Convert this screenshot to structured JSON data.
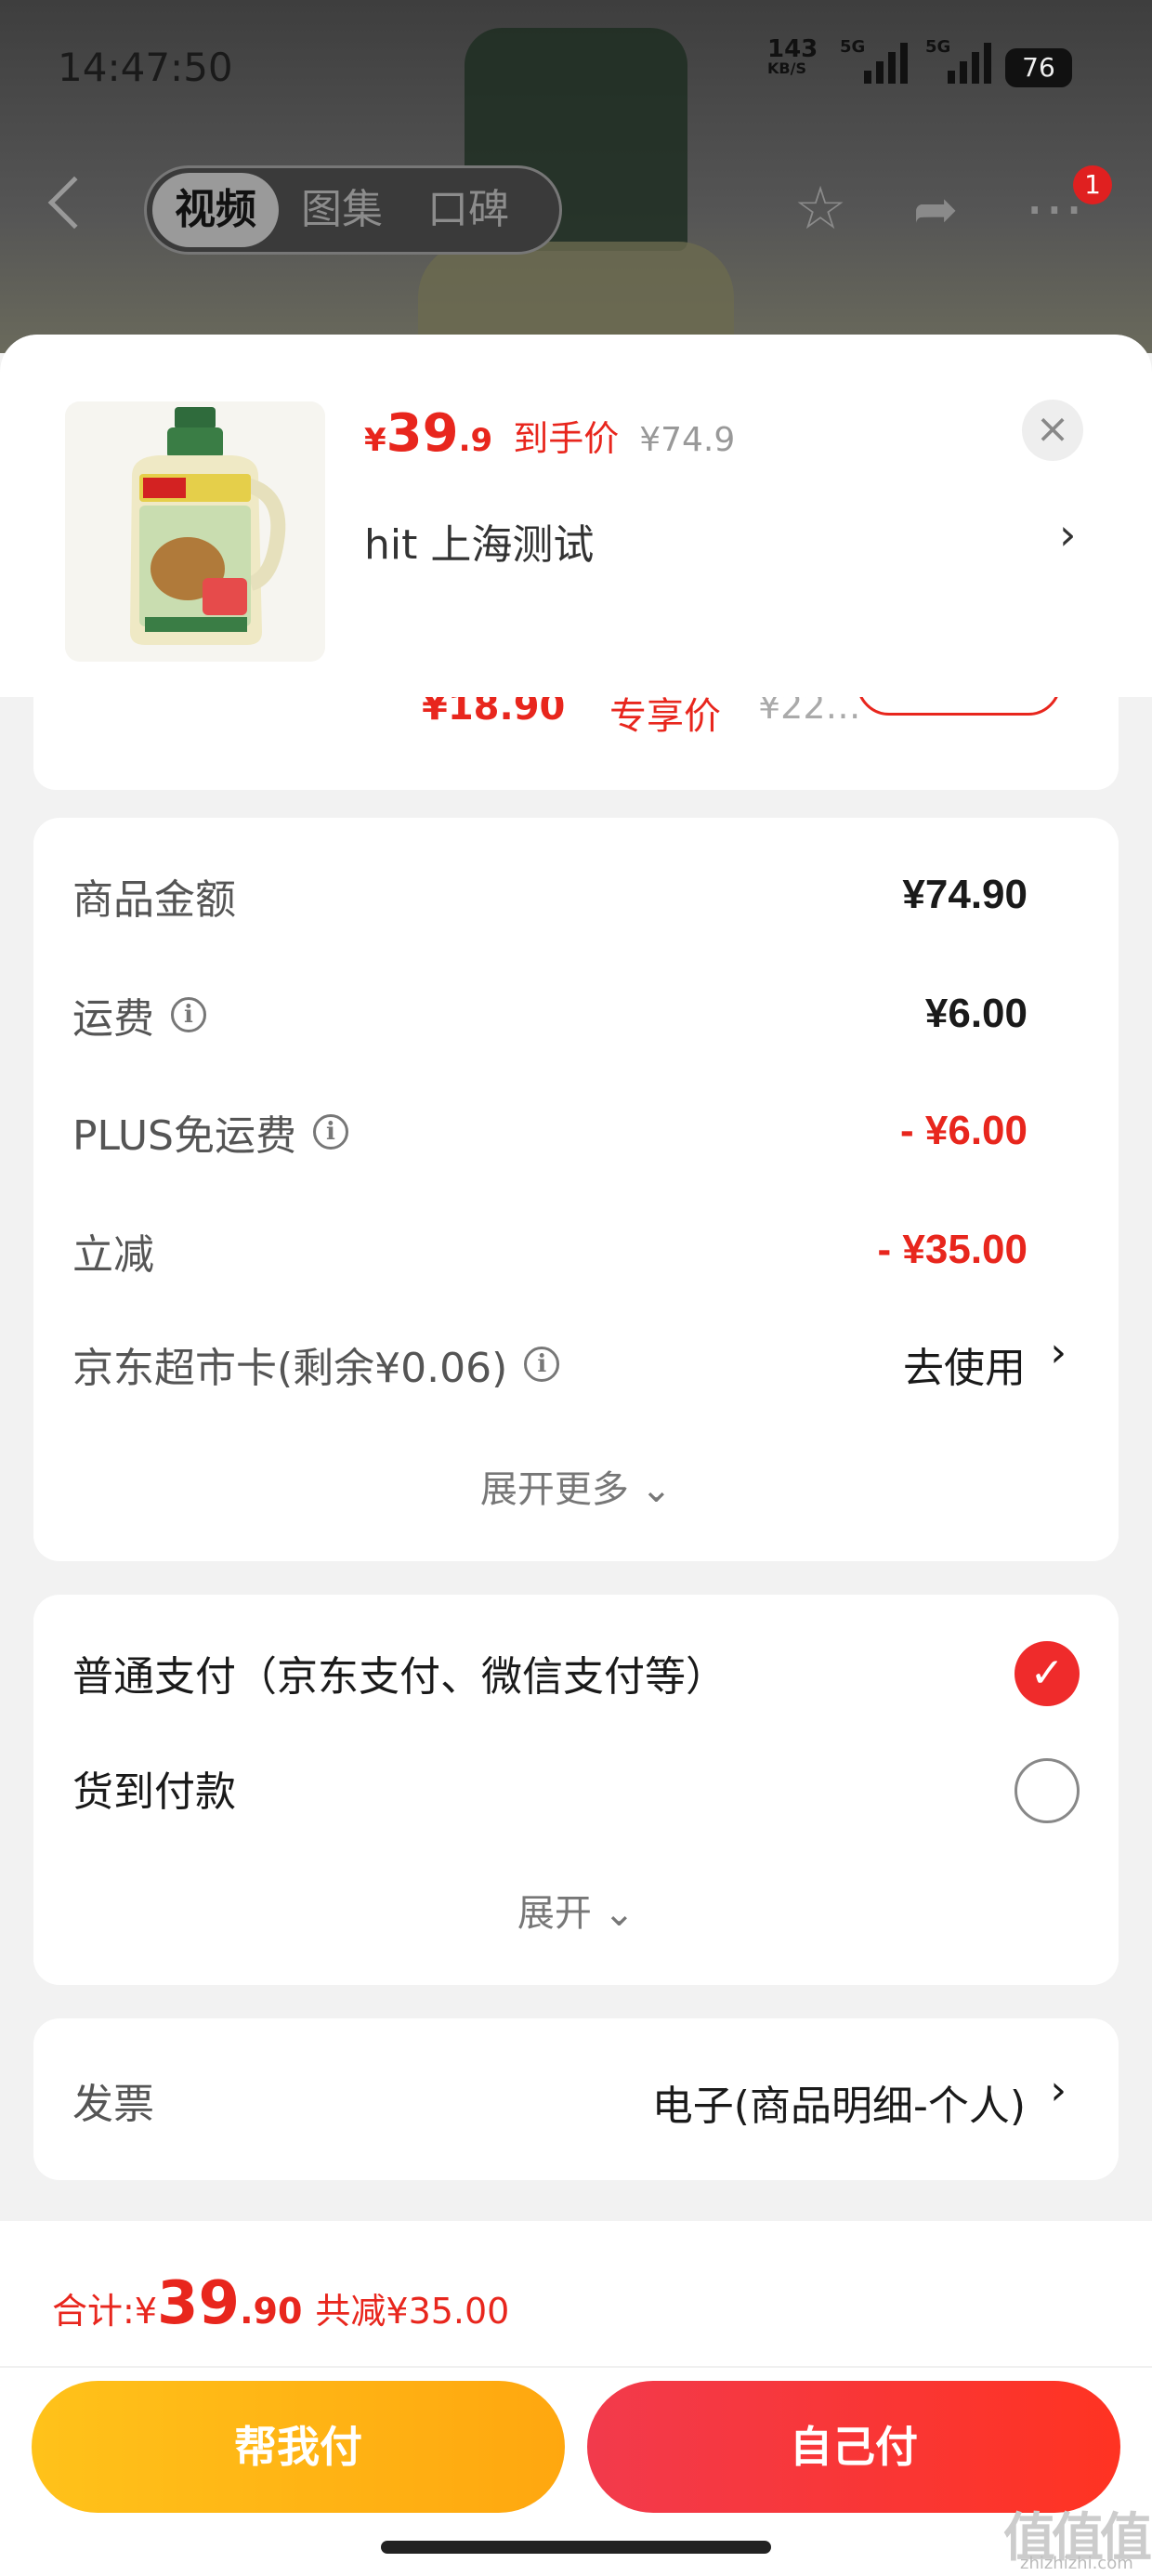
{
  "status_bar": {
    "time": "14:47:50",
    "speed_value": "143",
    "speed_unit": "KB/S",
    "net1": "5G",
    "net2": "5G",
    "battery": "76"
  },
  "nav": {
    "tabs": [
      "视频",
      "图集",
      "口碑"
    ],
    "active_tab": 0,
    "badge_count": "1"
  },
  "product": {
    "price_currency": "¥",
    "price_int": "39",
    "price_dec": ".9",
    "price_label": "到手价",
    "original_price": "¥74.9",
    "shop": "hit 上海测试",
    "close_icon": "close-icon"
  },
  "partial_row": {
    "price": "¥18.90",
    "label": "专享价",
    "orig": "¥22…"
  },
  "summary": {
    "rows": [
      {
        "label": "商品金额",
        "value": "¥74.90",
        "info": false,
        "red": false
      },
      {
        "label": "运费",
        "value": "¥6.00",
        "info": true,
        "red": false
      },
      {
        "label": "PLUS免运费",
        "value": "- ¥6.00",
        "info": true,
        "red": true
      },
      {
        "label": "立减",
        "value": "- ¥35.00",
        "info": false,
        "red": true
      }
    ],
    "card_label": "京东超市卡(剩余¥0.06)",
    "card_action": "去使用",
    "expand": "展开更多 ⌄"
  },
  "payment": {
    "options": [
      {
        "label": "普通支付（京东支付、微信支付等）",
        "selected": true
      },
      {
        "label": "货到付款",
        "selected": false
      }
    ],
    "expand": "展开 ⌄"
  },
  "invoice": {
    "label": "发票",
    "value": "电子(商品明细-个人)"
  },
  "footer": {
    "total_label": "合计: ",
    "currency": "¥",
    "total_int": "39",
    "total_dec": ".90",
    "discount": "共减¥35.00",
    "help_pay": "帮我付",
    "self_pay": "自己付"
  },
  "watermark": {
    "glyphs": "值值值",
    "site": "zhizhizhi.com"
  },
  "colors": {
    "accent_red": "#e8261d",
    "help_yellow": "#ffb515",
    "self_red": "#f5333f"
  }
}
